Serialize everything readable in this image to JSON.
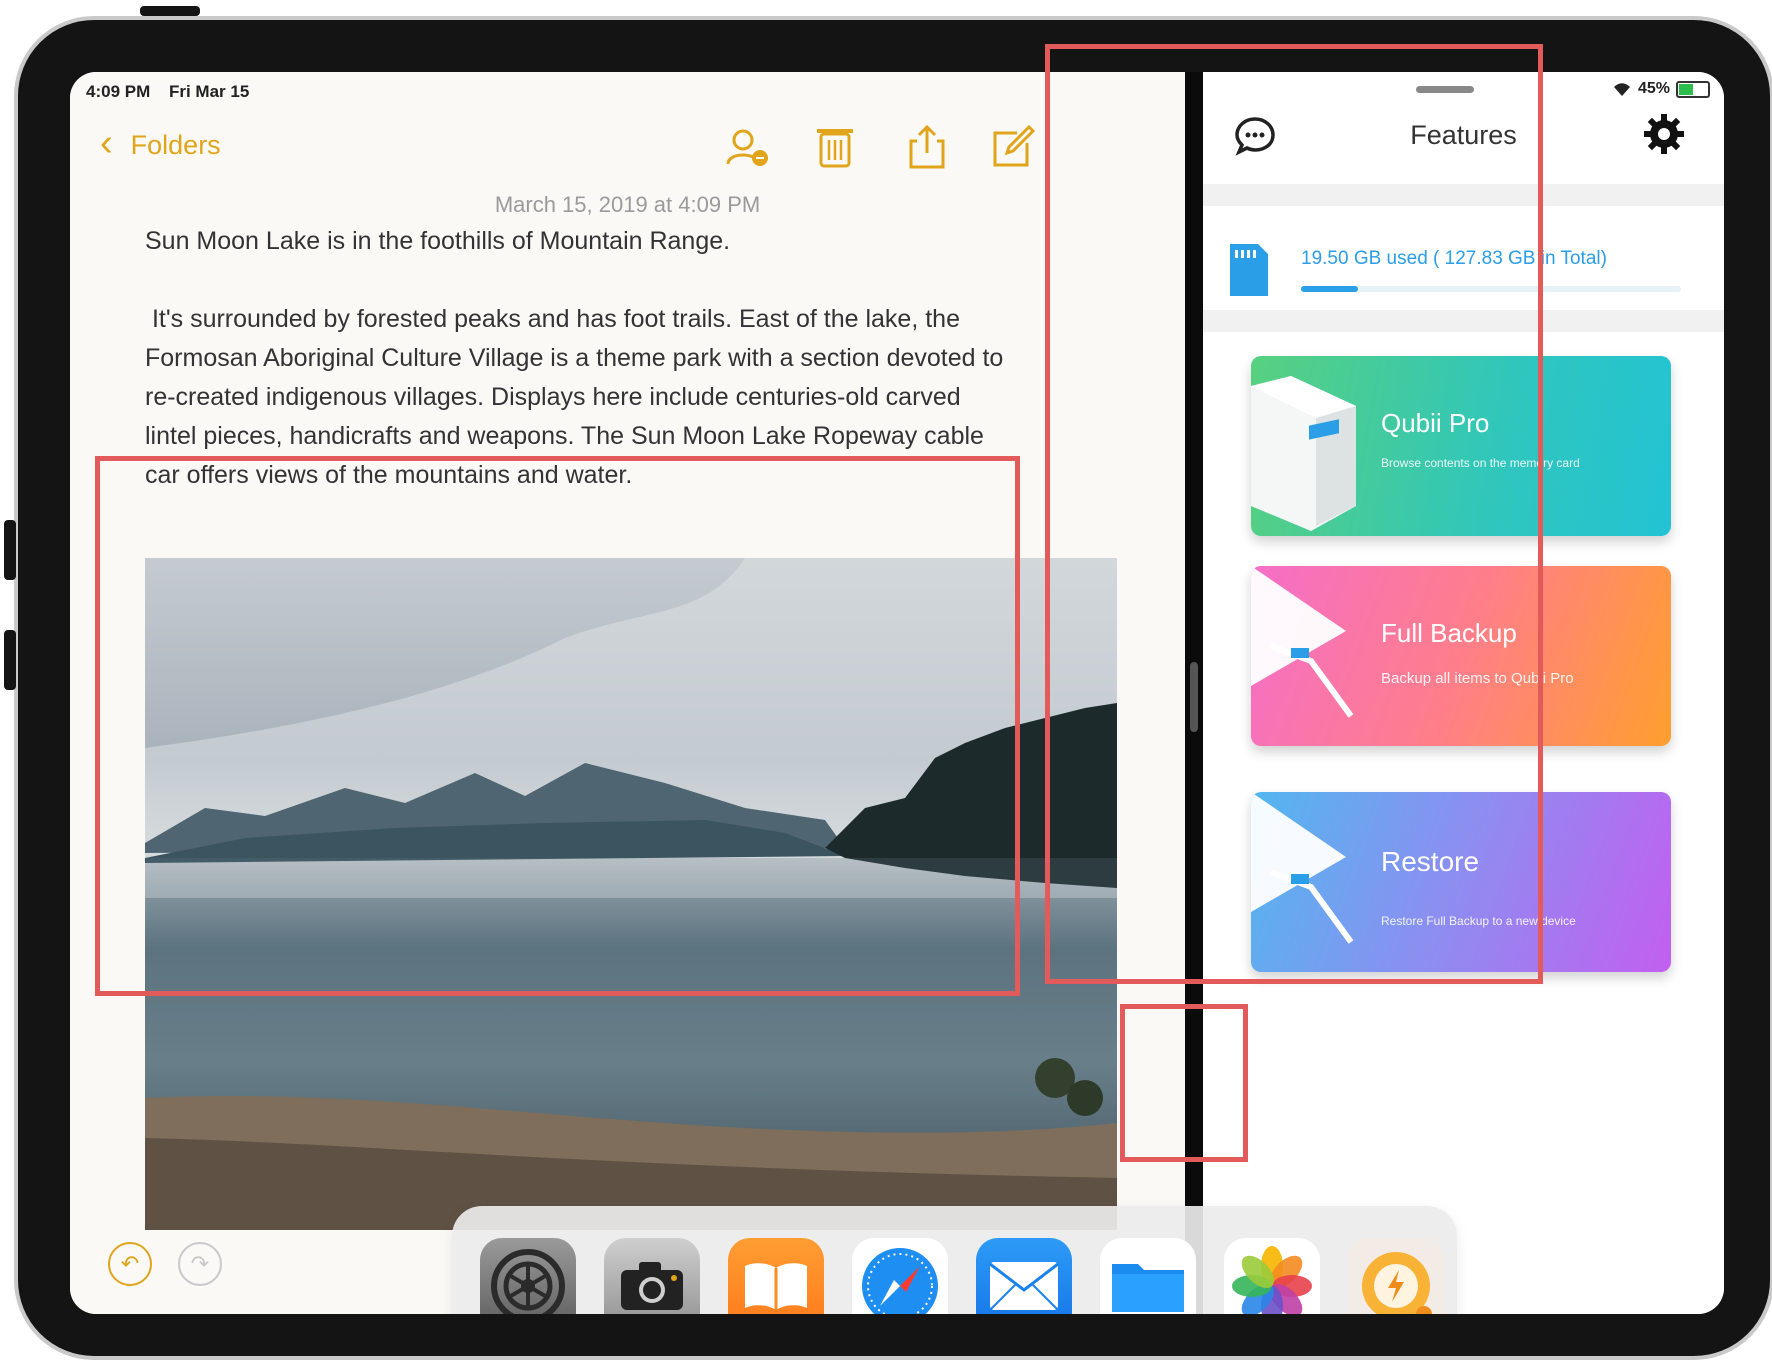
{
  "status_bar": {
    "time": "4:09 PM",
    "date": "Fri Mar 15",
    "battery": "45%"
  },
  "notes": {
    "back_label": "Folders",
    "timestamp": "March 15, 2019 at 4:09 PM",
    "body": "Sun Moon Lake is in the foothills of Mountain Range.\n\n It's surrounded by forested peaks and has foot trails. East of the lake, the\nFormosan Aboriginal Culture Village is a theme park with a section devoted to\nre-created indigenous villages. Displays here include centuries-old carved\nlintel pieces, handicrafts and weapons. The Sun Moon Lake Ropeway cable\ncar offers views of the mountains and water."
  },
  "features_panel": {
    "title": "Features",
    "storage_text": "19.50 GB used ( 127.83 GB in Total)",
    "storage_used_fraction": 0.15,
    "cards": [
      {
        "title": "Qubii Pro",
        "subtitle": "Browse contents on the memory card"
      },
      {
        "title": "Full Backup",
        "subtitle": "Backup all items to Qubii Pro"
      },
      {
        "title": "Restore",
        "subtitle": "Restore Full Backup to a new device"
      }
    ]
  },
  "dock": {
    "apps": [
      "settings-app-icon",
      "camera-app-icon",
      "books-app-icon",
      "safari-app-icon",
      "mail-app-icon",
      "files-app-icon",
      "photos-app-icon",
      "qubii-app-icon"
    ]
  },
  "colors": {
    "notes_accent": "#e0a51b",
    "highlight": "#e35a5a",
    "storage_blue": "#2a9ee6"
  }
}
